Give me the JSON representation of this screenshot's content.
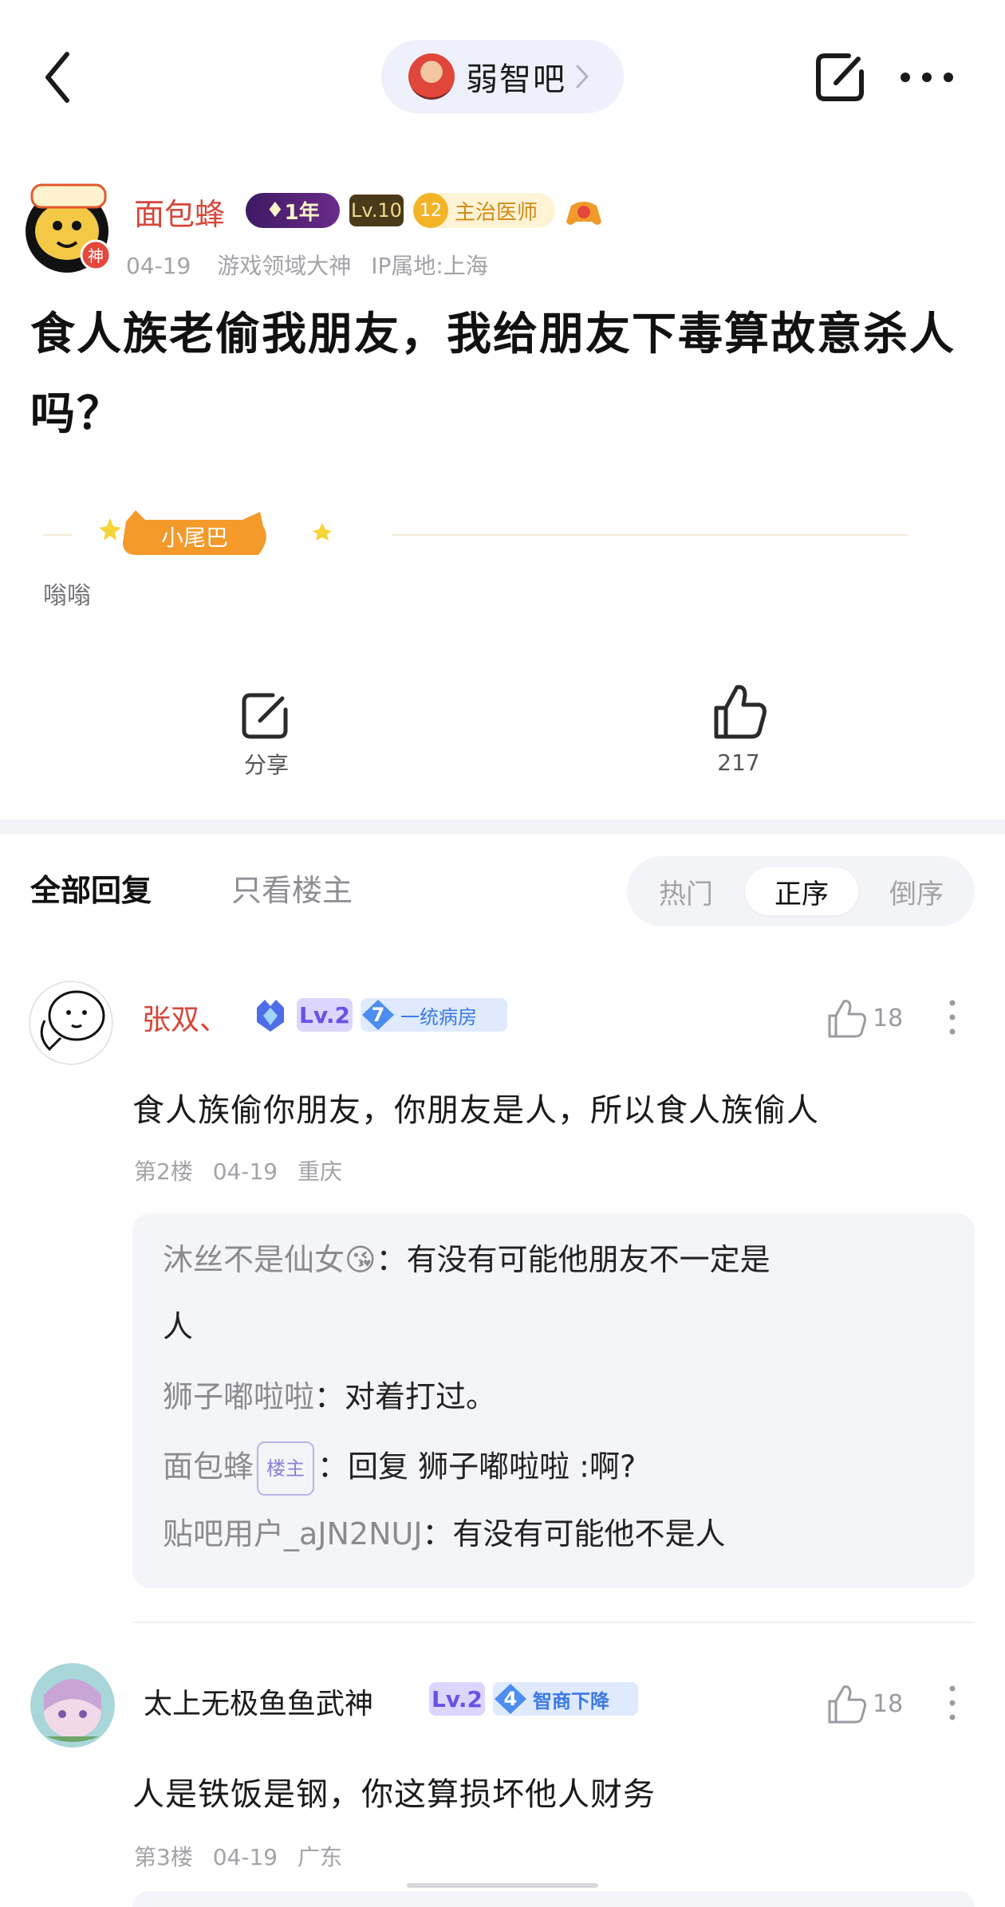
{
  "topbar": {
    "forum_name": "弱智吧"
  },
  "post": {
    "author": {
      "name": "面包蜂",
      "year_badge": "1年",
      "level_badge": "Lv.10",
      "rank_number": "12",
      "rank_title": "主治医师",
      "avatar_tag": "神",
      "date": "04-19",
      "title_tag": "游戏领域大神",
      "ip_location": "IP属地:上海"
    },
    "title": "食人族老偷我朋友，我给朋友下毒算故意杀人吗？",
    "tail": {
      "badge_label": "小尾巴",
      "text": "嗡嗡"
    },
    "actions": {
      "share_label": "分享",
      "like_count": "217"
    }
  },
  "tabs": {
    "all_replies": "全部回复",
    "host_only": "只看楼主",
    "sort": {
      "hot": "热门",
      "positive": "正序",
      "reverse": "倒序",
      "selected": "正序"
    }
  },
  "comments": [
    {
      "name": "张双、",
      "level": "Lv.2",
      "fan_level": "7",
      "fan_title": "一统病房",
      "likes": "18",
      "body": "食人族偷你朋友，你朋友是人，所以食人族偷人",
      "floor": "第2楼",
      "date": "04-19",
      "location": "重庆",
      "replies": [
        {
          "author": "沐丝不是仙女😘",
          "text": "：有没有可能他朋友不一定是",
          "text2": "人"
        },
        {
          "author": "狮子嘟啦啦",
          "text": "：对着打过。"
        },
        {
          "author": "面包蜂",
          "host_tag": "楼主",
          "text": "：回复 狮子嘟啦啦 :啊?"
        },
        {
          "author": "贴吧用户_aJN2NUJ",
          "text": "：有没有可能他不是人"
        }
      ]
    },
    {
      "name": "太上无极鱼鱼武神",
      "level": "Lv.2",
      "fan_level": "4",
      "fan_title": "智商下降",
      "likes": "18",
      "body": "人是铁饭是钢，你这算损坏他人财务",
      "floor": "第3楼",
      "date": "04-19",
      "location": "广东"
    }
  ],
  "colors": {
    "author_red": "#d6463a",
    "level_purple": "#6a52e8",
    "fan_blue": "#3c7ae8",
    "muted_gray": "#a3a3a8"
  }
}
